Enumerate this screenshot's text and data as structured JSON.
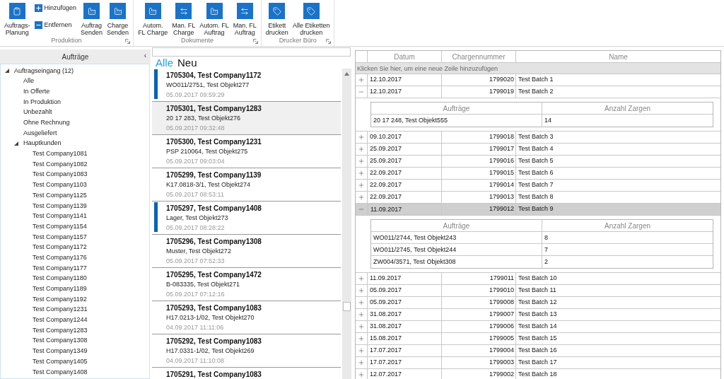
{
  "ribbon": {
    "groups": [
      {
        "label": "Produktion",
        "buttons": [
          {
            "kind": "large",
            "label": "Auftrags-\nPlanung"
          },
          {
            "kind": "stack",
            "items": [
              "Hinzufügen",
              "Entfernen"
            ]
          },
          {
            "kind": "large",
            "label": "Auftrag\nSenden"
          },
          {
            "kind": "large",
            "label": "Charge\nSenden"
          }
        ]
      },
      {
        "label": "Dokumente",
        "buttons": [
          {
            "kind": "large",
            "label": "Autom.\nFL Charge"
          },
          {
            "kind": "large",
            "label": "Man. FL\nCharge"
          },
          {
            "kind": "large",
            "label": "Autom. FL\nAuftrag"
          },
          {
            "kind": "large",
            "label": "Man. FL\nAuftrag"
          }
        ]
      },
      {
        "label": "Drucker Büro",
        "buttons": [
          {
            "kind": "large",
            "label": "Etikett\ndrucken"
          },
          {
            "kind": "large",
            "label": "Alle Etiketten\ndrucken"
          }
        ]
      }
    ]
  },
  "sidebar": {
    "title": "Aufträge",
    "collapse": "‹",
    "tree": [
      {
        "label": "Auftragseingang (12)",
        "expanded": true,
        "children": [
          {
            "label": "Alle"
          },
          {
            "label": "In Offerte"
          },
          {
            "label": "In Produktion"
          },
          {
            "label": "Unbezahlt"
          },
          {
            "label": "Ohne Rechnung"
          },
          {
            "label": "Ausgeliefert"
          },
          {
            "label": "Hauptkunden",
            "expanded": true,
            "children": [
              {
                "label": "Test Company1081"
              },
              {
                "label": "Test Company1082"
              },
              {
                "label": "Test Company1083"
              },
              {
                "label": "Test Company1103"
              },
              {
                "label": "Test Company1125"
              },
              {
                "label": "Test Company1139"
              },
              {
                "label": "Test Company1141"
              },
              {
                "label": "Test Company1154"
              },
              {
                "label": "Test Company1157"
              },
              {
                "label": "Test Company1172"
              },
              {
                "label": "Test Company1176"
              },
              {
                "label": "Test Company1177"
              },
              {
                "label": "Test Company1180"
              },
              {
                "label": "Test Company1189"
              },
              {
                "label": "Test Company1192"
              },
              {
                "label": "Test Company1231"
              },
              {
                "label": "Test Company1244"
              },
              {
                "label": "Test Company1283"
              },
              {
                "label": "Test Company1308"
              },
              {
                "label": "Test Company1349"
              },
              {
                "label": "Test Company1405"
              },
              {
                "label": "Test Company1408"
              }
            ]
          }
        ]
      }
    ]
  },
  "orders": {
    "tabs": [
      {
        "label": "Alle",
        "selected": true
      },
      {
        "label": "Neu",
        "selected": false
      }
    ],
    "items": [
      {
        "title": "1705304, Test Company1172",
        "subtitle": "WO011/2751, Test Objekt277",
        "time": "05.09.2017 09:59:29",
        "flagged": true,
        "selected": false
      },
      {
        "title": "1705301, Test Company1283",
        "subtitle": "20 17 283, Test Objekt276",
        "time": "05.09.2017 09:32:48",
        "flagged": false,
        "selected": true
      },
      {
        "title": "1705300, Test Company1231",
        "subtitle": "PSP 210064, Test Objekt275",
        "time": "05.09.2017 09:03:04",
        "flagged": false,
        "selected": false
      },
      {
        "title": "1705299, Test Company1139",
        "subtitle": "K17.0818-3/1, Test Objekt274",
        "time": "05.09.2017 08:53:11",
        "flagged": false,
        "selected": false
      },
      {
        "title": "1705297, Test Company1408",
        "subtitle": "Lager, Test Objekt273",
        "time": "05.09.2017 08:28:22",
        "flagged": true,
        "selected": false
      },
      {
        "title": "1705296, Test Company1308",
        "subtitle": "Muster, Test Objekt272",
        "time": "05.09.2017 07:52:33",
        "flagged": false,
        "selected": false
      },
      {
        "title": "1705295, Test Company1472",
        "subtitle": "B-083335, Test Objekt271",
        "time": "05.09.2017 07:12:16",
        "flagged": false,
        "selected": false
      },
      {
        "title": "1705293, Test Company1083",
        "subtitle": "H17.0213-1/02, Test Objekt270",
        "time": "04.09.2017 11:11:06",
        "flagged": false,
        "selected": false
      },
      {
        "title": "1705292, Test Company1083",
        "subtitle": "H17.0331-1/02, Test Objekt269",
        "time": "04.09.2017 11:10:08",
        "flagged": false,
        "selected": false
      },
      {
        "title": "1705291, Test Company1083",
        "flagged": false,
        "selected": false
      }
    ]
  },
  "batches": {
    "columns": [
      "Datum",
      "Chargennummer",
      "Name"
    ],
    "new_row_hint": "Klicken Sie hier, um eine neue Zeile hinzuzufügen",
    "rows": [
      {
        "expanded": false,
        "selected": false,
        "cells": [
          "12.10.2017",
          "1799020",
          "Test Batch 1"
        ]
      },
      {
        "expanded": true,
        "selected": false,
        "cells": [
          "12.10.2017",
          "1799019",
          "Test Batch 2"
        ],
        "details": {
          "columns": [
            "Aufträge",
            "Anzahl Zargen"
          ],
          "rows": [
            [
              "20 17 248, Test Objekt555",
              "14"
            ]
          ]
        }
      },
      {
        "expanded": false,
        "selected": false,
        "cells": [
          "09.10.2017",
          "1799018",
          "Test Batch 3"
        ]
      },
      {
        "expanded": false,
        "selected": false,
        "cells": [
          "25.09.2017",
          "1799017",
          "Test Batch 4"
        ]
      },
      {
        "expanded": false,
        "selected": false,
        "cells": [
          "25.09.2017",
          "1799016",
          "Test Batch 5"
        ]
      },
      {
        "expanded": false,
        "selected": false,
        "cells": [
          "22.09.2017",
          "1799015",
          "Test Batch 6"
        ]
      },
      {
        "expanded": false,
        "selected": false,
        "cells": [
          "22.09.2017",
          "1799014",
          "Test Batch 7"
        ]
      },
      {
        "expanded": false,
        "selected": false,
        "cells": [
          "22.09.2017",
          "1799013",
          "Test Batch 8"
        ]
      },
      {
        "expanded": true,
        "selected": true,
        "cells": [
          "11.09.2017",
          "1799012",
          "Test Batch 9"
        ],
        "details": {
          "columns": [
            "Aufträge",
            "Anzahl Zargen"
          ],
          "rows": [
            [
              "WO011/2744, Test Objekt243",
              "8"
            ],
            [
              "WO011/2745, Test Objekt244",
              "7"
            ],
            [
              "ZW004/3571, Test Objekt308",
              "2"
            ]
          ]
        }
      },
      {
        "expanded": false,
        "selected": false,
        "cells": [
          "11.09.2017",
          "1799011",
          "Test Batch 10"
        ]
      },
      {
        "expanded": false,
        "selected": false,
        "cells": [
          "05.09.2017",
          "1799010",
          "Test Batch 11"
        ]
      },
      {
        "expanded": false,
        "selected": false,
        "cells": [
          "05.09.2017",
          "1799008",
          "Test Batch 12"
        ]
      },
      {
        "expanded": false,
        "selected": false,
        "cells": [
          "31.08.2017",
          "1799007",
          "Test Batch 13"
        ]
      },
      {
        "expanded": false,
        "selected": false,
        "cells": [
          "31.08.2017",
          "1799006",
          "Test Batch 14"
        ]
      },
      {
        "expanded": false,
        "selected": false,
        "cells": [
          "15.08.2017",
          "1799005",
          "Test Batch 15"
        ]
      },
      {
        "expanded": false,
        "selected": false,
        "cells": [
          "17.07.2017",
          "1799004",
          "Test Batch 16"
        ]
      },
      {
        "expanded": false,
        "selected": false,
        "cells": [
          "17.07.2017",
          "1799003",
          "Test Batch 17"
        ]
      },
      {
        "expanded": false,
        "selected": false,
        "cells": [
          "12.07.2017",
          "1799002",
          "Test Batch 18"
        ]
      }
    ]
  }
}
